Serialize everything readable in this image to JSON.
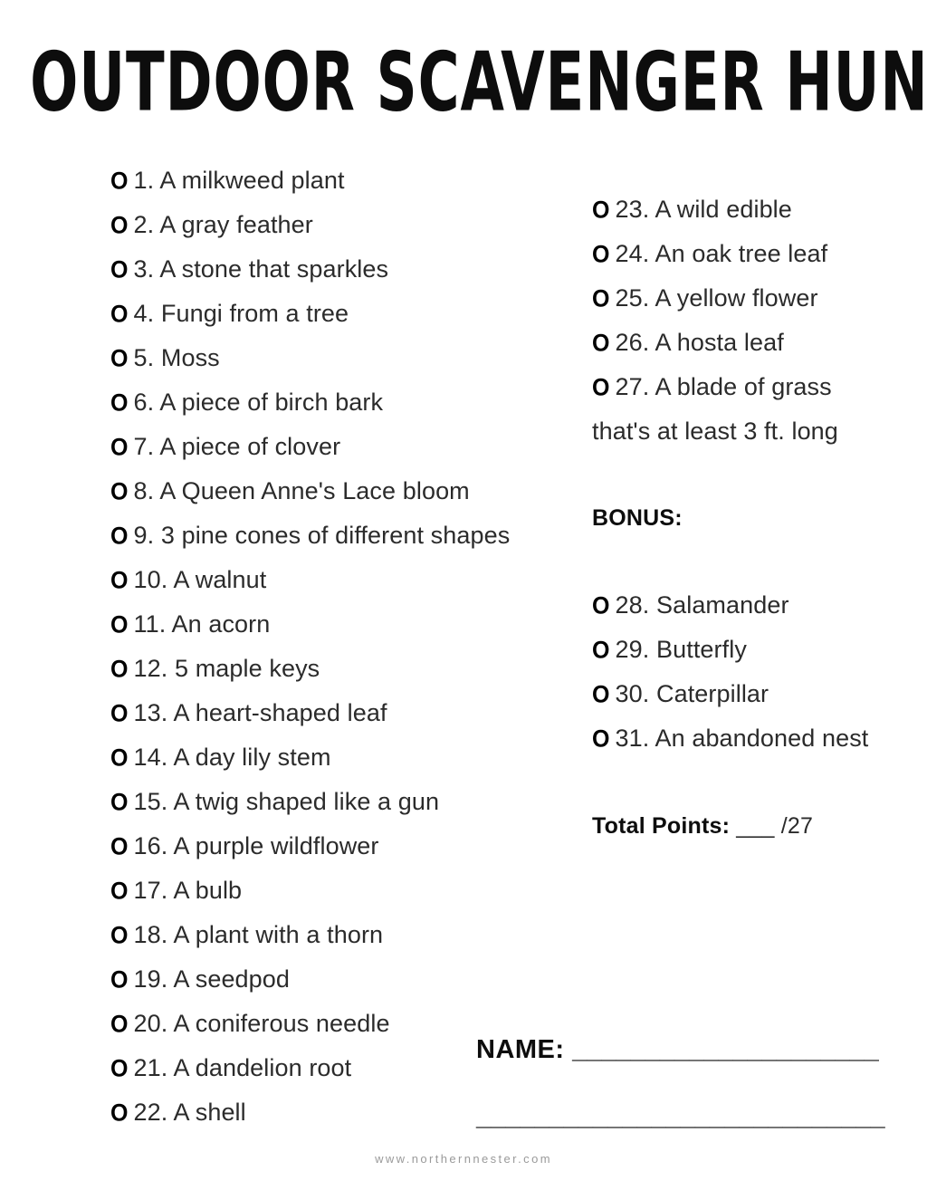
{
  "document": {
    "title": "OUTDOOR SCAVENGER HUNT",
    "bullet_glyph": "O",
    "accent_color": "#0d0d0d",
    "text_color": "#2b2b2b",
    "footer_color": "#9a9a9a",
    "background_color": "#ffffff"
  },
  "left_column": {
    "items": [
      {
        "number": "1.",
        "text": "A milkweed plant"
      },
      {
        "number": "2.",
        "text": "A gray feather"
      },
      {
        "number": "3.",
        "text": "A stone that sparkles"
      },
      {
        "number": "4.",
        "text": "Fungi from a tree"
      },
      {
        "number": "5.",
        "text": "Moss"
      },
      {
        "number": "6.",
        "text": "A piece of birch bark"
      },
      {
        "number": "7.",
        "text": "A piece of clover"
      },
      {
        "number": "8.",
        "text": "A Queen Anne's Lace bloom"
      },
      {
        "number": "9.",
        "text": "3 pine cones of different shapes"
      },
      {
        "number": "10.",
        "text": "A walnut"
      },
      {
        "number": "11.",
        "text": "An acorn"
      },
      {
        "number": "12.",
        "text": "5 maple keys"
      },
      {
        "number": "13.",
        "text": "A heart-shaped leaf"
      },
      {
        "number": "14.",
        "text": "A day lily stem"
      },
      {
        "number": "15.",
        "text": "A twig shaped like a gun"
      },
      {
        "number": "16.",
        "text": "A purple wildflower"
      },
      {
        "number": "17.",
        "text": "A bulb"
      },
      {
        "number": "18.",
        "text": "A plant with a thorn"
      },
      {
        "number": "19.",
        "text": "A seedpod"
      },
      {
        "number": "20.",
        "text": "A coniferous needle"
      },
      {
        "number": "21.",
        "text": "A dandelion root"
      },
      {
        "number": "22.",
        "text": "A shell"
      }
    ]
  },
  "right_column": {
    "items": [
      {
        "number": "23.",
        "text": "A wild edible"
      },
      {
        "number": "24.",
        "text": "An oak tree leaf"
      },
      {
        "number": "25.",
        "text": "A yellow flower"
      },
      {
        "number": "26.",
        "text": "A hosta leaf"
      },
      {
        "number": "27.",
        "text": "A blade of grass that's at least 3 ft. long"
      }
    ],
    "bonus": {
      "heading": "BONUS:",
      "items": [
        {
          "number": "28.",
          "text": "Salamander"
        },
        {
          "number": "29.",
          "text": "Butterfly"
        },
        {
          "number": "30.",
          "text": "Caterpillar"
        },
        {
          "number": "31.",
          "text": "An abandoned nest"
        }
      ]
    },
    "total_points": {
      "label": "Total Points:",
      "value": "___ /27"
    }
  },
  "name_field": {
    "label": "NAME:",
    "rule": "_____________________",
    "rule_second": "____________________________"
  },
  "footer": {
    "website": "www.northernnester.com"
  }
}
